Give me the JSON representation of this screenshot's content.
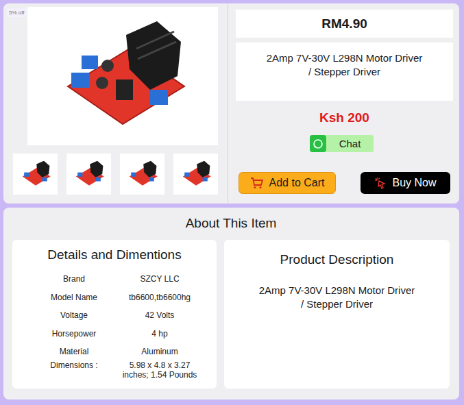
{
  "badge": "5% off",
  "gallery": {
    "thumbnails": [
      {
        "selected": false
      },
      {
        "selected": false
      },
      {
        "selected": false
      },
      {
        "selected": false
      }
    ]
  },
  "price": "RM4.90",
  "title": "2Amp 7V-30V L298N Motor Driver / Stepper Driver",
  "local_price": "Ksh 200",
  "chat_button": "Chat",
  "add_to_cart_button": "Add to Cart",
  "buy_now_button": "Buy Now",
  "about": {
    "title": "About This Item",
    "details": {
      "title": "Details and Dimentions",
      "rows": [
        {
          "label": "Brand",
          "value": "SZCY LLC"
        },
        {
          "label": "Model Name",
          "value": "tb6600,tb6600hg"
        },
        {
          "label": "Voltage",
          "value": "42 Volts"
        },
        {
          "label": "Horsepower",
          "value": "4 hp"
        },
        {
          "label": "Material",
          "value": "Aluminum"
        },
        {
          "label": "Dimensions :",
          "value": "5.98 x 4.8 x 3.27 inches; 1.54 Pounds"
        }
      ]
    },
    "description": {
      "title": "Product Description",
      "text": "2Amp 7V-30V L298N Motor Driver / Stepper Driver"
    }
  }
}
